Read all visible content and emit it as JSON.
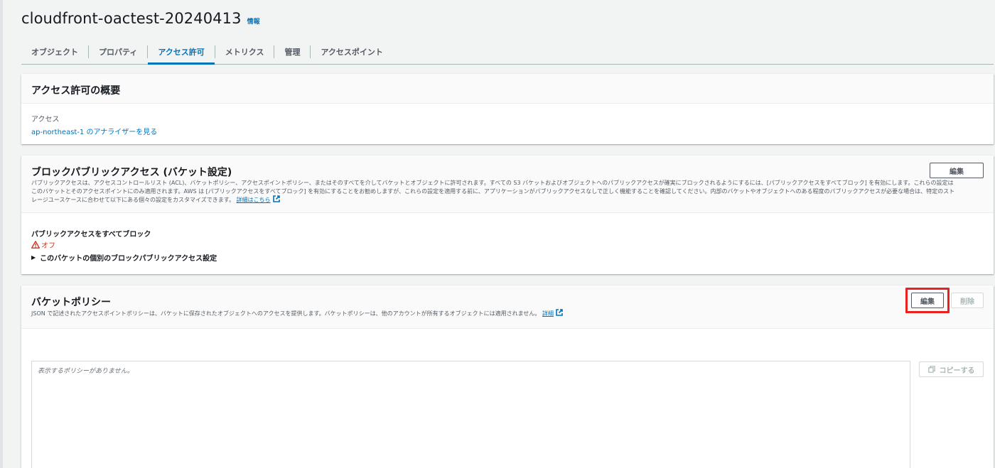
{
  "header": {
    "bucket_name": "cloudfront-oactest-20240413",
    "info_label": "情報"
  },
  "tabs": [
    {
      "label": "オブジェクト",
      "active": false
    },
    {
      "label": "プロパティ",
      "active": false
    },
    {
      "label": "アクセス許可",
      "active": true
    },
    {
      "label": "メトリクス",
      "active": false
    },
    {
      "label": "管理",
      "active": false
    },
    {
      "label": "アクセスポイント",
      "active": false
    }
  ],
  "overview": {
    "title": "アクセス許可の概要",
    "access_label": "アクセス",
    "analyzer_link": "ap-northeast-1 のアナライザーを見る"
  },
  "block_public_access": {
    "title": "ブロックパブリックアクセス (バケット設定)",
    "description_line1": "パブリックアクセスは、アクセスコントロールリスト (ACL)、バケットポリシー、アクセスポイントポリシー、またはそのすべてを介してバケットとオブジェクトに許可されます。すべての S3 バケットおよびオブジェクトへのパブリックアクセスが確実にブロックされるようにするには、[パブリックアクセスをすべてブロック] を有効にします。これらの設定は",
    "description_line2": "このバケットとそのアクセスポイントにのみ適用されます。AWS は [パブリックアクセスをすべてブロック] を有効にすることをお勧めしますが、これらの設定を適用する前に、アプリケーションがパブリックアクセスなしで正しく機能することを確認してください。内部のバケットやオブジェクトへのある程度のパブリックアクセスが必要な場合は、特定のスト",
    "description_line3": "レージユースケースに合わせて以下にある個々の設定をカスタマイズできます。",
    "learn_more": "詳細はこちら",
    "edit_label": "編集",
    "block_all_label": "パブリックアクセスをすべてブロック",
    "block_all_status": "オフ",
    "status_color": "#d13212",
    "expander_label": "このバケットの個別のブロックパブリックアクセス設定"
  },
  "bucket_policy": {
    "title": "バケットポリシー",
    "description": "JSON で記述されたアクセスポイントポリシーは、バケットに保存されたオブジェクトへのアクセスを提供します。バケットポリシーは、他のアカウントが所有するオブジェクトには適用されません。",
    "details_link": "詳細",
    "edit_label": "編集",
    "delete_label": "削除",
    "empty_text": "表示するポリシーがありません。",
    "copy_label": "コピーする"
  },
  "colors": {
    "accent": "#0073bb",
    "highlight": "#e8221f"
  }
}
